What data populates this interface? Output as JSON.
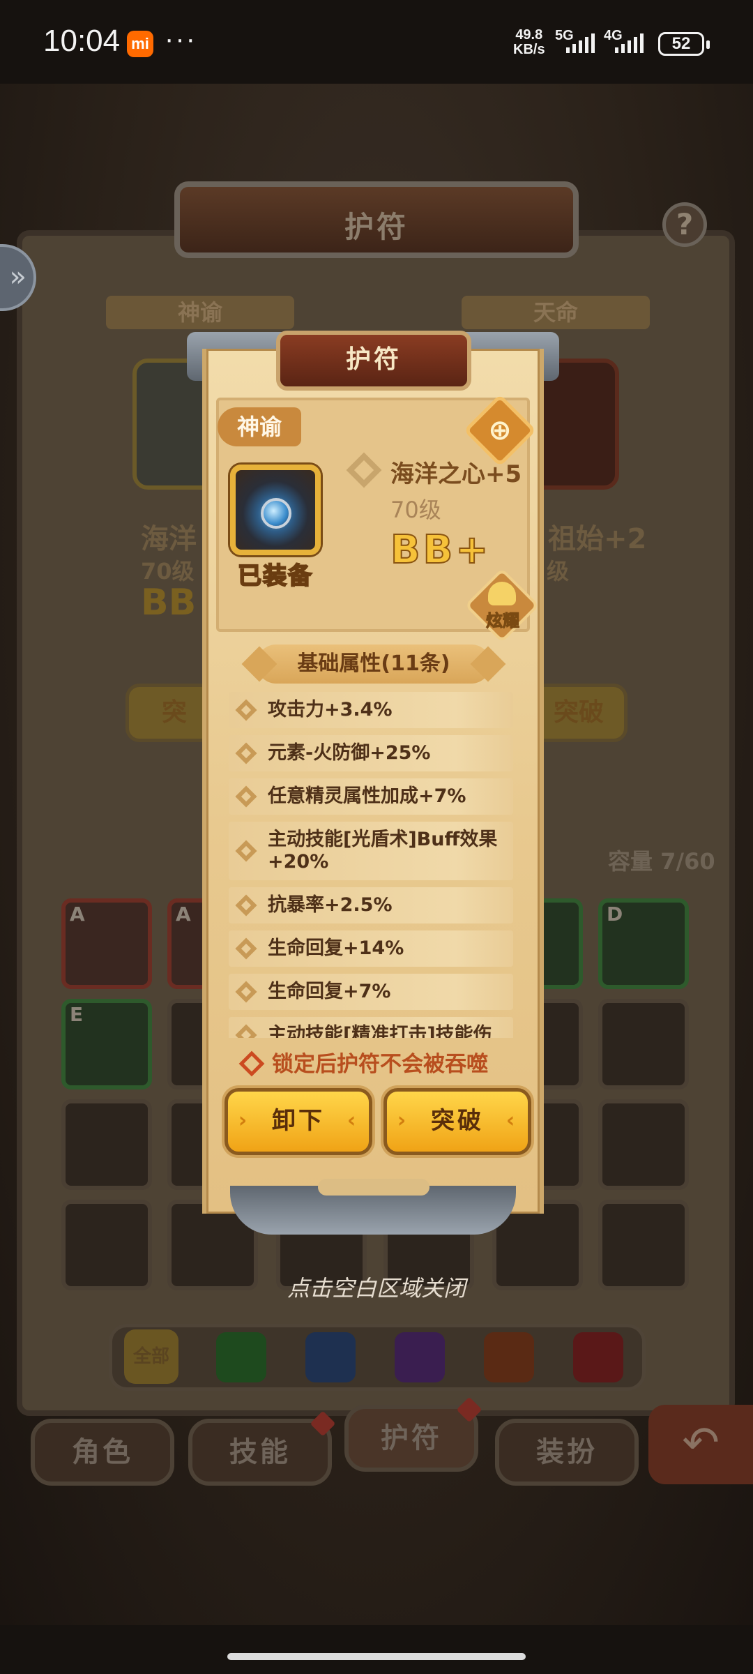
{
  "status_bar": {
    "time": "10:04",
    "app_badge": "mi",
    "overflow": "···",
    "speed_value": "49.8",
    "speed_unit": "KB/s",
    "net_1": "5G",
    "net_2": "4G",
    "battery": "52"
  },
  "background": {
    "header_title": "护符",
    "help": "?",
    "side_tab": "»",
    "left_ribbon": "神谕",
    "right_ribbon": "天命",
    "left_name": "海洋",
    "left_level": "70级",
    "left_grade": "BB",
    "right_name": "祖始+2",
    "right_level": "级",
    "left_button": "突",
    "right_button": "突破",
    "capacity": "容量 7/60",
    "grid_letters": [
      "A",
      "A",
      "D",
      "E"
    ],
    "gem_filter_all": "全部",
    "gem_colors": [
      "#1e4a1e",
      "#1e3050",
      "#3a1e50",
      "#5a2a14",
      "#5a1818"
    ],
    "nav": [
      "角色",
      "技能",
      "护符",
      "装扮"
    ],
    "back_icon": "↶",
    "close_hint": "点击空白区域关闭"
  },
  "modal": {
    "title": "护符",
    "tag": "神谕",
    "lock_icon": "🔒",
    "equipped": "已装备",
    "name": "海洋之心+5",
    "level": "70级",
    "grade": "BB+",
    "flair_label": "炫耀",
    "section_title": "基础属性(11条)",
    "attributes": [
      "攻击力+3.4%",
      "元素-火防御+25%",
      "任意精灵属性加成+7%",
      "主动技能[光盾术]Buff效果+20%",
      "抗暴率+2.5%",
      "生命回复+14%",
      "生命回复+7%",
      "主动技能[精准打击]技能伤"
    ],
    "lock_hint": "锁定后护符不会被吞噬",
    "unequip_button": "卸下",
    "breakthrough_button": "突破"
  }
}
